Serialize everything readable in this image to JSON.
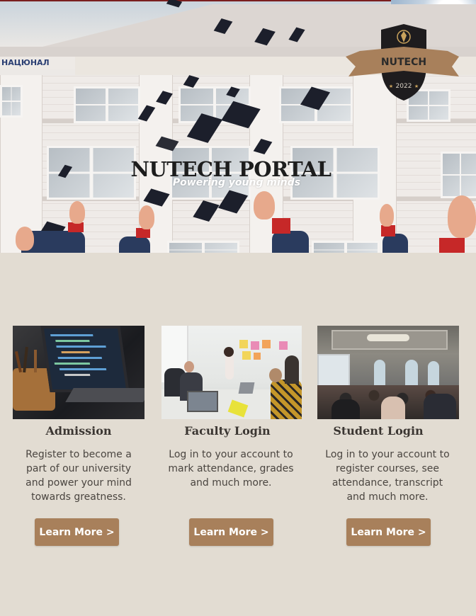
{
  "hero": {
    "title": "NUTECH PORTAL",
    "tagline": "Powering young minds",
    "building_sign": "НАЦЮНАЛ"
  },
  "badge": {
    "name": "NUTECH",
    "year": "2022",
    "colors": {
      "shield": "#1e1c1e",
      "ribbon": "#a8805b",
      "text": "#2a2a2a",
      "gold": "#c9a25c"
    }
  },
  "cards": [
    {
      "heading": "Admission",
      "description": "Register to become a part of our university and power your mind towards greatness.",
      "button": "Learn More >",
      "image_alt": "laptop-code-image"
    },
    {
      "heading": "Faculty Login",
      "description": "Log in to your account to mark attendance, grades and much more.",
      "button": "Learn More >",
      "image_alt": "meeting-room-image"
    },
    {
      "heading": "Student Login",
      "description": "Log in to your account to register courses, see attendance, transcript and much more.",
      "button": "Learn More >",
      "image_alt": "lecture-hall-image"
    }
  ],
  "colors": {
    "background": "#e2dcd2",
    "button": "#a8805b",
    "heading": "#3b3632",
    "body_text": "#4a4540"
  }
}
